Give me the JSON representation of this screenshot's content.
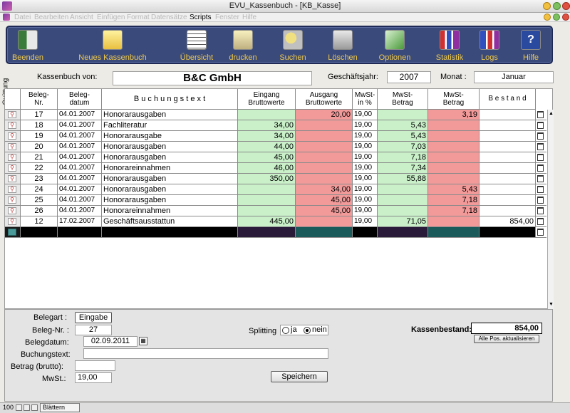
{
  "window": {
    "title": "EVU_Kassenbuch - [KB_Kasse]"
  },
  "menu": [
    "Datei",
    "Bearbeiten",
    "Ansicht",
    "Einfügen",
    "Format",
    "Datensätze",
    "Scripts",
    "Fenster",
    "Hilfe"
  ],
  "toolbar": [
    {
      "label": "Beenden",
      "icon": "exit-door-icon"
    },
    {
      "label": "Neues Kassenbuch",
      "icon": "new-book-icon"
    },
    {
      "label": "Übersicht",
      "icon": "overview-icon"
    },
    {
      "label": "drucken",
      "icon": "printer-icon"
    },
    {
      "label": "Suchen",
      "icon": "search-icon"
    },
    {
      "label": "Löschen",
      "icon": "trash-icon"
    },
    {
      "label": "Optionen",
      "icon": "options-icon"
    },
    {
      "label": "Statistik",
      "icon": "statistics-icon"
    },
    {
      "label": "Logs",
      "icon": "logs-icon"
    },
    {
      "label": "Hilfe",
      "icon": "help-icon"
    }
  ],
  "header": {
    "kassenbuch_label": "Kassenbuch von:",
    "company": "B&C GmbH",
    "year_label": "Geschäftsjahr:",
    "year": "2007",
    "month_label": "Monat :",
    "month": "Januar",
    "quittung_label": "Quittung"
  },
  "columns": {
    "nr": "Beleg-\nNr.",
    "datum": "Beleg-\ndatum",
    "text": "B u c h u n g s t e x t",
    "eingang": "Eingang\nBruttowerte",
    "ausgang": "Ausgang\nBruttowerte",
    "mwst": "MwSt-\nin %",
    "mwst_betrag1": "MwSt-\nBetrag",
    "mwst_betrag2": "MwSt-\nBetrag",
    "bestand": "B e s t a n d"
  },
  "rows": [
    {
      "nr": "17",
      "datum": "04.01.2007",
      "text": "Honorarausgaben",
      "eingang": "",
      "ausgang": "20,00",
      "mwst": "19,00",
      "mb1": "",
      "mb2": "3,19",
      "bestand": ""
    },
    {
      "nr": "18",
      "datum": "04.01.2007",
      "text": "Fachliteratur",
      "eingang": "34,00",
      "ausgang": "",
      "mwst": "19,00",
      "mb1": "5,43",
      "mb2": "",
      "bestand": ""
    },
    {
      "nr": "19",
      "datum": "04.01.2007",
      "text": "Honorarausgabe",
      "eingang": "34,00",
      "ausgang": "",
      "mwst": "19,00",
      "mb1": "5,43",
      "mb2": "",
      "bestand": ""
    },
    {
      "nr": "20",
      "datum": "04.01.2007",
      "text": "Honorarausgaben",
      "eingang": "44,00",
      "ausgang": "",
      "mwst": "19,00",
      "mb1": "7,03",
      "mb2": "",
      "bestand": ""
    },
    {
      "nr": "21",
      "datum": "04.01.2007",
      "text": "Honorarausgaben",
      "eingang": "45,00",
      "ausgang": "",
      "mwst": "19,00",
      "mb1": "7,18",
      "mb2": "",
      "bestand": ""
    },
    {
      "nr": "22",
      "datum": "04.01.2007",
      "text": "Honorareinnahmen",
      "eingang": "46,00",
      "ausgang": "",
      "mwst": "19,00",
      "mb1": "7,34",
      "mb2": "",
      "bestand": ""
    },
    {
      "nr": "23",
      "datum": "04.01.2007",
      "text": "Honorarausgaben",
      "eingang": "350,00",
      "ausgang": "",
      "mwst": "19,00",
      "mb1": "55,88",
      "mb2": "",
      "bestand": ""
    },
    {
      "nr": "24",
      "datum": "04.01.2007",
      "text": "Honorarausgaben",
      "eingang": "",
      "ausgang": "34,00",
      "mwst": "19,00",
      "mb1": "",
      "mb2": "5,43",
      "bestand": ""
    },
    {
      "nr": "25",
      "datum": "04.01.2007",
      "text": "Honorarausgaben",
      "eingang": "",
      "ausgang": "45,00",
      "mwst": "19,00",
      "mb1": "",
      "mb2": "7,18",
      "bestand": ""
    },
    {
      "nr": "26",
      "datum": "04.01.2007",
      "text": "Honorareinnahmen",
      "eingang": "",
      "ausgang": "45,00",
      "mwst": "19,00",
      "mb1": "",
      "mb2": "7,18",
      "bestand": ""
    },
    {
      "nr": "12",
      "datum": "17.02.2007",
      "text": "Geschäftsausstattun",
      "eingang": "445,00",
      "ausgang": "",
      "mwst": "19,00",
      "mb1": "71,05",
      "mb2": "",
      "bestand": "854,00"
    }
  ],
  "form": {
    "belegart_label": "Belegart :",
    "belegart_value": "Eingabe",
    "belegnr_label": "Beleg-Nr. :",
    "belegnr_value": "27",
    "belegdatum_label": "Belegdatum:",
    "belegdatum_value": "02.09.2011",
    "buchungstext_label": "Buchungstext:",
    "buchungstext_value": "",
    "betrag_label": "Betrag (brutto):",
    "betrag_value": "",
    "mwst_label": "MwSt.:",
    "mwst_value": "19,00",
    "splitting_label": "Splitting",
    "splitting_ja": "ja",
    "splitting_nein": "nein",
    "save_label": "Speichern",
    "kassenbestand_label": "Kassenbestand:",
    "kassenbestand_value": "854,00",
    "refresh_label": "Alle Pos. aktualisieren"
  },
  "statusbar": {
    "zoom": "100",
    "mode": "Blättern"
  },
  "colors": {
    "green": "#c9f0c9",
    "red": "#f29a9a",
    "toolbar": "#3a4a7a",
    "toolbar_text": "#f0c94a"
  }
}
